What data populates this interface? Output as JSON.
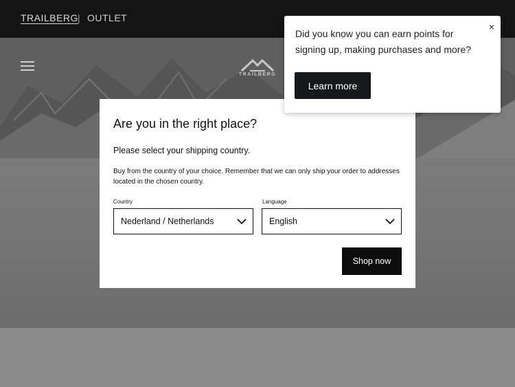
{
  "topbar": {
    "brand_label": "TRAILBERG",
    "separator": "|",
    "outlet_label": "OUTLET"
  },
  "hero": {
    "logo_text": "TRAILBERG"
  },
  "modal": {
    "title": "Are you in the right place?",
    "subtitle": "Please select your shipping country.",
    "description": "Buy from the country of your choice. Remember that we can only ship your order to addresses located in the chosen country.",
    "country_label": "Country",
    "country_value": "Nederland / Netherlands",
    "language_label": "Language",
    "language_value": "English",
    "shop_button": "Shop now"
  },
  "popup": {
    "message": "Did you know you can earn points for signing up, making purchases and more?",
    "learn_button": "Learn more",
    "close_symbol": "×"
  },
  "colors": {
    "topbar_bg": "#141414",
    "button_bg": "#0c0c0c",
    "modal_bg": "#ffffff"
  }
}
